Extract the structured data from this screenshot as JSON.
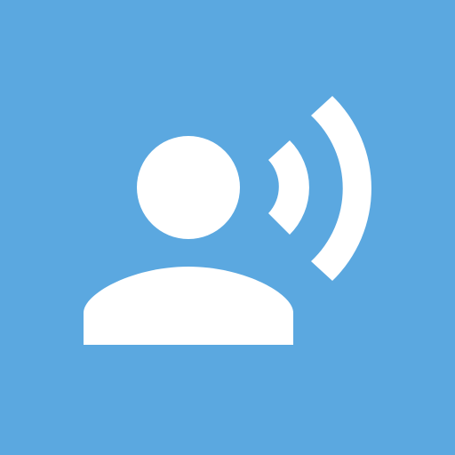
{
  "app_icon": {
    "icon": "voice-broadcast-icon",
    "background_color": "#5ba8e0",
    "foreground_color": "#ffffff",
    "parts": {
      "person_head": "person-head-icon",
      "person_body": "person-body-icon",
      "signal_wave_inner": "signal-wave-inner-icon",
      "signal_wave_outer": "signal-wave-outer-icon"
    }
  }
}
